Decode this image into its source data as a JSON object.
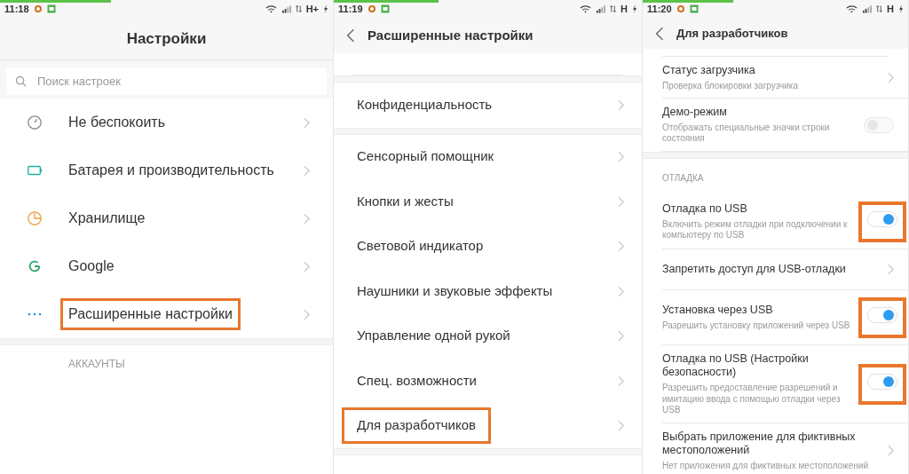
{
  "panels": [
    {
      "status_bar": {
        "time": "11:18",
        "network": "H+"
      },
      "title": "Настройки",
      "back": false,
      "items": [
        {
          "kind": "search",
          "placeholder": "Поиск настроек"
        },
        {
          "kind": "row",
          "label": "Не беспокоить",
          "highlighted": false
        },
        {
          "kind": "row",
          "label": "Батарея и производительность",
          "highlighted": false
        },
        {
          "kind": "row",
          "label": "Хранилище",
          "highlighted": false
        },
        {
          "kind": "row",
          "label": "Google",
          "highlighted": false
        },
        {
          "kind": "row",
          "label": "Расширенные настройки",
          "highlighted": true
        },
        {
          "kind": "gap"
        },
        {
          "kind": "section",
          "label": "АККАУНТЫ"
        }
      ]
    },
    {
      "status_bar": {
        "time": "11:19",
        "network": "H"
      },
      "title": "Расширенные настройки",
      "back": true,
      "items": [
        {
          "kind": "spacer"
        },
        {
          "kind": "gap"
        },
        {
          "kind": "row",
          "label": "Конфиденциальность",
          "highlighted": false
        },
        {
          "kind": "gap"
        },
        {
          "kind": "row",
          "label": "Сенсорный помощник",
          "highlighted": false
        },
        {
          "kind": "row",
          "label": "Кнопки и жесты",
          "highlighted": false
        },
        {
          "kind": "row",
          "label": "Световой индикатор",
          "highlighted": false
        },
        {
          "kind": "row",
          "label": "Наушники и звуковые эффекты",
          "highlighted": false
        },
        {
          "kind": "row",
          "label": "Управление одной рукой",
          "highlighted": false
        },
        {
          "kind": "row",
          "label": "Спец. возможности",
          "highlighted": false
        },
        {
          "kind": "row",
          "label": "Для разработчиков",
          "highlighted": true
        },
        {
          "kind": "gap"
        }
      ]
    },
    {
      "status_bar": {
        "time": "11:20",
        "network": "H"
      },
      "title": "Для разработчиков",
      "back": true,
      "items": [
        {
          "kind": "spacer"
        },
        {
          "kind": "row",
          "label": "Статус загрузчика",
          "sub": "Проверка блокировки загрузчика",
          "highlighted": false
        },
        {
          "kind": "toggle",
          "label": "Демо-режим",
          "sub": "Отображать специальные значки строки состояния",
          "on": false,
          "highlighted": false
        },
        {
          "kind": "gap"
        },
        {
          "kind": "section",
          "label": "ОТЛАДКА"
        },
        {
          "kind": "toggle",
          "label": "Отладка по USB",
          "sub": "Включить режим отладки при подключении к компьютеру по USB",
          "on": true,
          "highlighted": true
        },
        {
          "kind": "row",
          "label": "Запретить доступ для USB-отладки",
          "highlighted": false
        },
        {
          "kind": "toggle",
          "label": "Установка через USB",
          "sub": "Разрешить установку приложений через USB",
          "on": true,
          "highlighted": true
        },
        {
          "kind": "toggle",
          "label": "Отладка по USB (Настройки безопасности)",
          "sub": "Разрешить предоставление разрешений и имитацию ввода с помощью отладки через USB",
          "on": true,
          "highlighted": true
        },
        {
          "kind": "row",
          "label": "Выбрать приложение для фиктивных местоположений",
          "sub": "Нет приложения для фиктивных местоположений",
          "highlighted": false
        }
      ]
    }
  ]
}
